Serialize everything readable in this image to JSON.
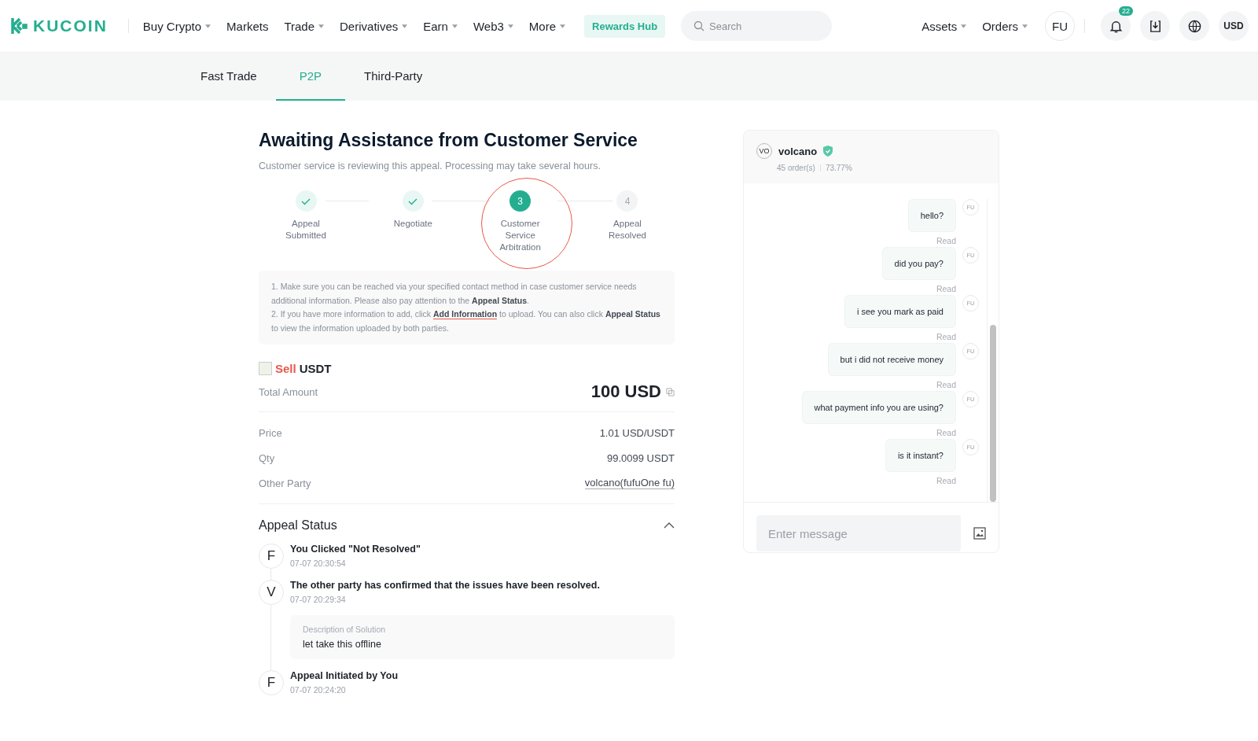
{
  "header": {
    "logo": "KUCOIN",
    "nav": [
      {
        "label": "Buy Crypto",
        "dropdown": true
      },
      {
        "label": "Markets",
        "dropdown": false
      },
      {
        "label": "Trade",
        "dropdown": true
      },
      {
        "label": "Derivatives",
        "dropdown": true
      },
      {
        "label": "Earn",
        "dropdown": true
      },
      {
        "label": "Web3",
        "dropdown": true
      },
      {
        "label": "More",
        "dropdown": true
      }
    ],
    "rewards": "Rewards Hub",
    "search": {
      "placeholder": "Search"
    },
    "menus": [
      {
        "label": "Assets",
        "dropdown": true
      },
      {
        "label": "Orders",
        "dropdown": true
      }
    ],
    "avatar": "FU",
    "notifications": "22",
    "currency": "USD"
  },
  "tabs": [
    {
      "label": "Fast Trade",
      "selected": false
    },
    {
      "label": "P2P",
      "selected": true
    },
    {
      "label": "Third-Party",
      "selected": false
    }
  ],
  "title": "Awaiting Assistance from Customer Service",
  "subtitle": "Customer service is reviewing this appeal. Processing may take several hours.",
  "steps": [
    {
      "label": "Appeal Submitted",
      "kind": "done"
    },
    {
      "label": "Negotiate",
      "kind": "done"
    },
    {
      "label": "Customer Service Arbitration",
      "kind": "current",
      "number": "3"
    },
    {
      "label": "Appeal Resolved",
      "kind": "upcoming",
      "number": "4"
    }
  ],
  "notes": {
    "line1": "1. Make sure you can be reached via your specified contact method in case customer service needs additional information. Please also pay attention to the **Appeal Status**.",
    "line2_before": "2. If you have more information to add, click ",
    "line2_link": "Add Information",
    "line2_after": " to upload. You can also click **Appeal Status** to view the information uploaded by both parties."
  },
  "order": {
    "side": "Sell",
    "asset": "USDT",
    "total_label": "Total Amount",
    "total": "100 USD",
    "rows": [
      {
        "label": "Price",
        "value": "1.01 USD/USDT",
        "link": false
      },
      {
        "label": "Qty",
        "value": "99.0099 USDT",
        "link": false
      },
      {
        "label": "Other Party",
        "value": "volcano(fufuOne fu)",
        "link": true
      }
    ]
  },
  "appeal_status": {
    "title": "Appeal Status",
    "expanded": true,
    "events": [
      {
        "avatar": "F",
        "title": "You Clicked \"Not Resolved\"",
        "time": "07-07 20:30:54"
      },
      {
        "avatar": "V",
        "title": "The other party has confirmed that the issues have been resolved.",
        "time": "07-07 20:29:34",
        "detail": {
          "label": "Description of Solution",
          "value": "let take this offline"
        }
      },
      {
        "avatar": "F",
        "title": "Appeal Initiated by You",
        "time": "07-07 20:24:20"
      }
    ]
  },
  "chat": {
    "avatar": "VO",
    "name": "volcano",
    "orders": "45 order(s)",
    "rate": "73.77%",
    "messages": [
      {
        "text": "hello?",
        "status": "Read",
        "avatar": "FU"
      },
      {
        "text": "did you pay?",
        "status": "Read",
        "avatar": "FU"
      },
      {
        "text": "i see you mark as paid",
        "status": "Read",
        "avatar": "FU"
      },
      {
        "text": "but i did not receive money",
        "status": "Read",
        "avatar": "FU"
      },
      {
        "text": "what payment info you are using?",
        "status": "Read",
        "avatar": "FU"
      },
      {
        "text": "is it instant?",
        "status": "Read",
        "avatar": "FU"
      }
    ],
    "input": {
      "placeholder": "Enter message"
    }
  }
}
